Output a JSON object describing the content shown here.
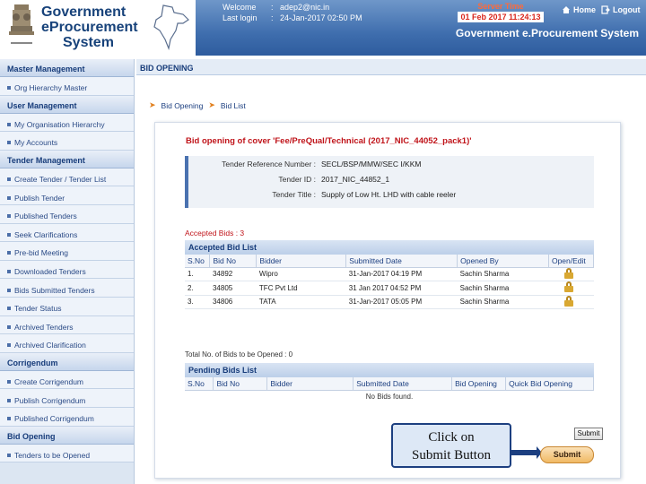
{
  "header": {
    "logo_line1": "Government",
    "logo_line2": "eProcurement",
    "logo_line3": "System",
    "welcome_label": "Welcome",
    "welcome_value": "adep2@nic.in",
    "lastlogin_label": "Last login",
    "lastlogin_value": "24-Jan-2017 02:50 PM",
    "server_time_label": "Server Time",
    "server_time_value": "01 Feb 2017 11:24:13",
    "home": "Home",
    "logout": "Logout",
    "system_title": "Government e.Procurement System"
  },
  "sidebar": {
    "sections": [
      {
        "title": "Master Management",
        "items": [
          "Org Hierarchy Master"
        ]
      },
      {
        "title": "User Management",
        "items": [
          "My Organisation Hierarchy",
          "My Accounts"
        ]
      },
      {
        "title": "Tender Management",
        "items": [
          "Create Tender / Tender List",
          "Publish Tender",
          "Published Tenders",
          "Seek Clarifications",
          "Pre-bid Meeting",
          "Downloaded Tenders",
          "Bids Submitted Tenders",
          "Tender Status",
          "Archived Tenders",
          "Archived Clarification"
        ]
      },
      {
        "title": "Corrigendum",
        "items": [
          "Create Corrigendum",
          "Publish Corrigendum",
          "Published Corrigendum"
        ]
      },
      {
        "title": "Bid Opening",
        "items": [
          "Tenders to be Opened"
        ]
      }
    ]
  },
  "main": {
    "page_title": "BID OPENING",
    "breadcrumb": [
      "Bid Opening",
      "Bid List"
    ],
    "cover_title": "Bid opening of cover 'Fee/PreQual/Technical (2017_NIC_44052_pack1)'",
    "tender": {
      "ref_label": "Tender Reference Number :",
      "ref_value": "SECL/BSP/MMW/SEC I/KKM",
      "id_label": "Tender ID :",
      "id_value": "2017_NIC_44852_1",
      "title_label": "Tender Title :",
      "title_value": "Supply of Low Ht. LHD with cable reeler"
    },
    "accepted_count": "Accepted Bids : 3",
    "accepted_title": "Accepted Bid List",
    "accepted_headers": [
      "S.No",
      "Bid No",
      "Bidder",
      "Submitted Date",
      "Opened By",
      "Open/Edit"
    ],
    "accepted_rows": [
      [
        "1.",
        "34892",
        "Wipro",
        "31-Jan-2017 04:19 PM",
        "Sachin Sharma"
      ],
      [
        "2.",
        "34805",
        "TFC Pvt Ltd",
        "31 Jan 2017 04:52 PM",
        "Sachin Sharma"
      ],
      [
        "3.",
        "34806",
        "TATA",
        "31-Jan-2017 05:05 PM",
        "Sachin Sharma"
      ]
    ],
    "pending_note": "Total No. of Bids to be Opened : 0",
    "pending_title": "Pending Bids List",
    "pending_headers": [
      "S.No",
      "Bid No",
      "Bidder",
      "Submitted Date",
      "Bid Opening",
      "Quick Bid Opening"
    ],
    "no_bids": "No Bids found.",
    "submit_small": "Submit",
    "submit_main": "Submit"
  },
  "callout": {
    "line1": "Click on",
    "line2": "Submit Button"
  }
}
